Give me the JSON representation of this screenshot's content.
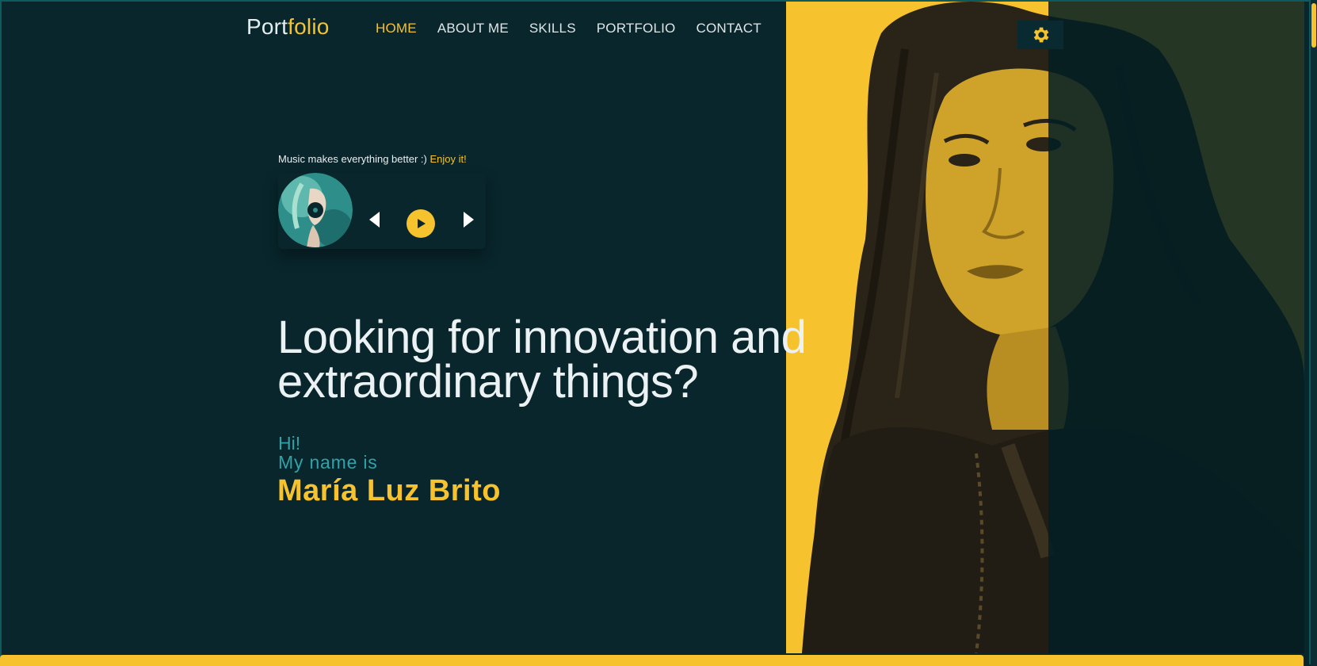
{
  "header": {
    "logo_part1": "Port",
    "logo_part2": "folio",
    "nav": [
      {
        "label": "HOME",
        "active": true
      },
      {
        "label": "ABOUT ME",
        "active": false
      },
      {
        "label": "SKILLS",
        "active": false
      },
      {
        "label": "PORTFOLIO",
        "active": false
      },
      {
        "label": "CONTACT",
        "active": false
      }
    ],
    "settings_icon": "gear-icon"
  },
  "music": {
    "tagline": "Music makes everything better :)",
    "enjoy": "Enjoy it!",
    "controls": [
      "prev-icon",
      "play-icon",
      "next-icon"
    ]
  },
  "hero": {
    "headline_line1": "Looking for innovation and",
    "headline_line2": "extraordinary things?",
    "greeting": "Hi!",
    "intro": "My name is",
    "name": "María Luz Brito"
  },
  "colors": {
    "background": "#08262c",
    "accent": "#f6c22d",
    "teal_text": "#2fa3a8"
  }
}
